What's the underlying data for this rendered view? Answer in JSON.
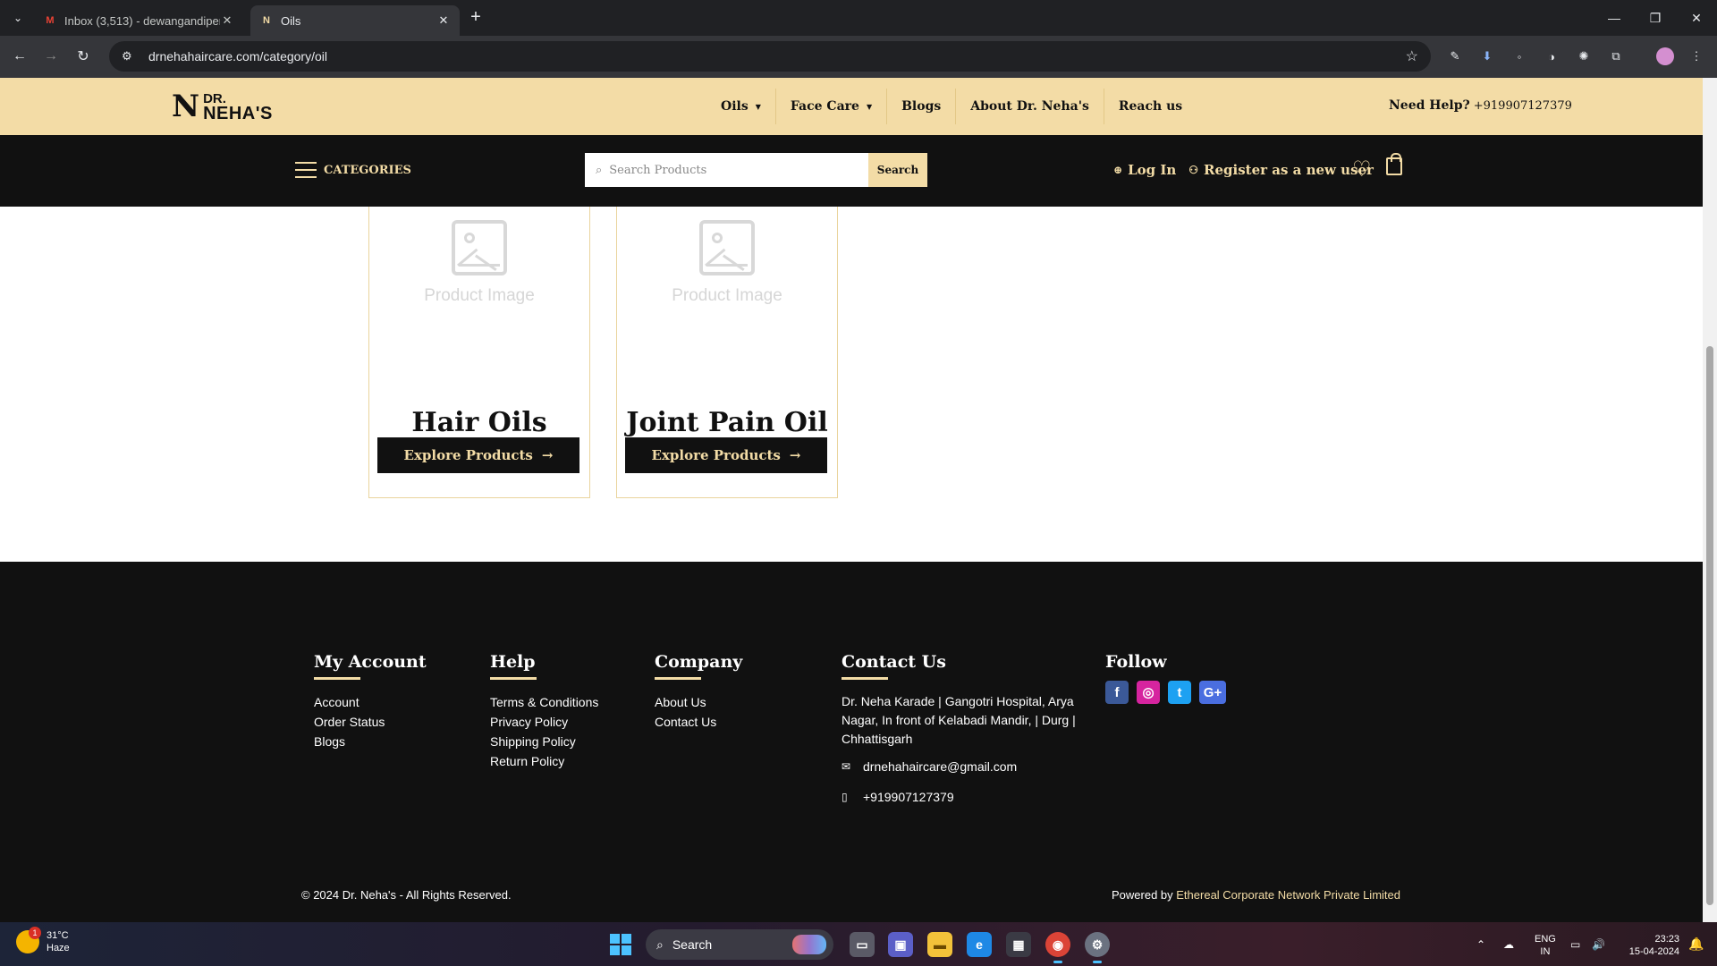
{
  "browser": {
    "tabs": [
      {
        "title": "Inbox (3,513) - dewangandipen",
        "icon": "gmail-icon"
      },
      {
        "title": "Oils",
        "icon": "drneha-favicon"
      }
    ],
    "url": "drnehahaircare.com/category/oil"
  },
  "site": {
    "logo": {
      "line1": "DR.",
      "line2": "NEHA'S",
      "mark": "N"
    },
    "menu": [
      {
        "label": "Oils",
        "dropdown": true
      },
      {
        "label": "Face Care",
        "dropdown": true
      },
      {
        "label": "Blogs",
        "dropdown": false
      },
      {
        "label": "About Dr. Neha's",
        "dropdown": false
      },
      {
        "label": "Reach us",
        "dropdown": false
      }
    ],
    "need_help": "Need Help?",
    "phone": "+919907127379",
    "categories_label": "CATEGORIES",
    "search": {
      "placeholder": "Search Products",
      "button": "Search"
    },
    "login": "Log In",
    "register": "Register as a new user"
  },
  "products": [
    {
      "placeholder": "Product Image",
      "title": "Hair Oils",
      "button": "Explore Products"
    },
    {
      "placeholder": "Product Image",
      "title": "Joint Pain Oil",
      "button": "Explore Products"
    }
  ],
  "footer": {
    "my_account": {
      "heading": "My Account",
      "links": [
        "Account",
        "Order Status",
        "Blogs"
      ]
    },
    "help": {
      "heading": "Help",
      "links": [
        "Terms & Conditions",
        "Privacy Policy",
        "Shipping Policy",
        "Return Policy"
      ]
    },
    "company": {
      "heading": "Company",
      "links": [
        "About Us",
        "Contact Us"
      ]
    },
    "contact": {
      "heading": "Contact Us",
      "address": "Dr. Neha Karade | Gangotri Hospital, Arya Nagar, In front of Kelabadi Mandir, | Durg | Chhattisgarh",
      "email": "drnehahaircare@gmail.com",
      "phone": "+919907127379"
    },
    "follow": {
      "heading": "Follow",
      "socials": [
        "facebook-icon",
        "instagram-icon",
        "twitter-icon",
        "google-plus-icon"
      ]
    },
    "copyright": "© 2024 Dr. Neha's - All Rights Reserved.",
    "powered_by": "Powered by",
    "company_name": "Ethereal Corporate Network Private Limited"
  },
  "taskbar": {
    "temp": "31°C",
    "weather": "Haze",
    "weather_badge": "1",
    "search": "Search",
    "lang1": "ENG",
    "lang2": "IN",
    "time": "23:23",
    "date": "15-04-2024"
  },
  "colors": {
    "accent": "#f3dca6",
    "dark": "#111111"
  }
}
